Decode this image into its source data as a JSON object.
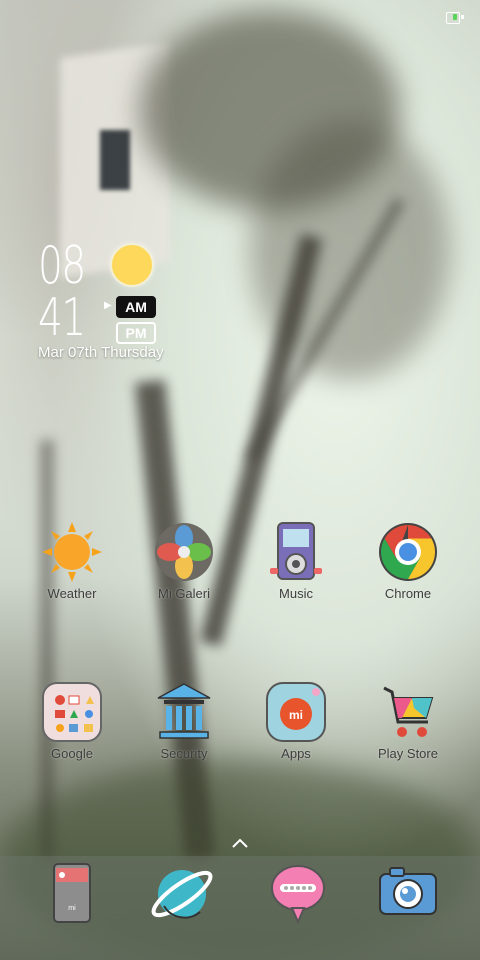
{
  "status_bar": {
    "battery_icon": "battery-charging-icon"
  },
  "clock": {
    "hour": "08",
    "minute": "41",
    "am_label": "AM",
    "pm_label": "PM",
    "date": "Mar 07th Thursday",
    "weather_icon": "sun-icon"
  },
  "apps": [
    {
      "label": "Weather",
      "icon": "weather-sun-icon"
    },
    {
      "label": "Mi Galeri",
      "icon": "gallery-flower-icon"
    },
    {
      "label": "Music",
      "icon": "music-player-icon"
    },
    {
      "label": "Chrome",
      "icon": "chrome-icon"
    },
    {
      "label": "Google",
      "icon": "google-folder-icon"
    },
    {
      "label": "Security",
      "icon": "security-bank-icon"
    },
    {
      "label": "Apps",
      "icon": "mi-apps-icon"
    },
    {
      "label": "Play Store",
      "icon": "shopping-cart-icon"
    }
  ],
  "dock": {
    "handle_icon": "chevron-up-icon",
    "items": [
      {
        "icon": "mi-phone-icon"
      },
      {
        "icon": "planet-browser-icon"
      },
      {
        "icon": "message-bubble-icon"
      },
      {
        "icon": "camera-icon"
      }
    ]
  },
  "colors": {
    "accent_yellow": "#fed85a",
    "chrome_red": "#e04a3a",
    "chrome_blue": "#4a90e2"
  }
}
